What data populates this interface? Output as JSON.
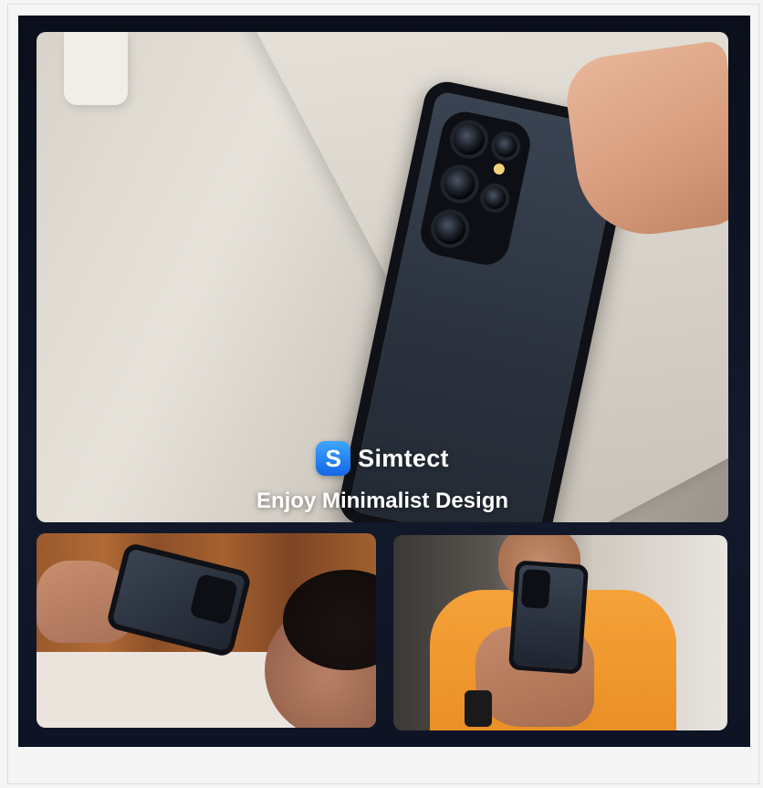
{
  "brand": {
    "logo_letter": "S",
    "name": "Simtect"
  },
  "hero": {
    "tagline": "Enjoy Minimalist Design"
  },
  "colors": {
    "panel_bg": "#0b0f1c",
    "logo_blue": "#1466e6",
    "text": "#ffffff"
  },
  "icons": [
    "simtect-logo-icon"
  ]
}
